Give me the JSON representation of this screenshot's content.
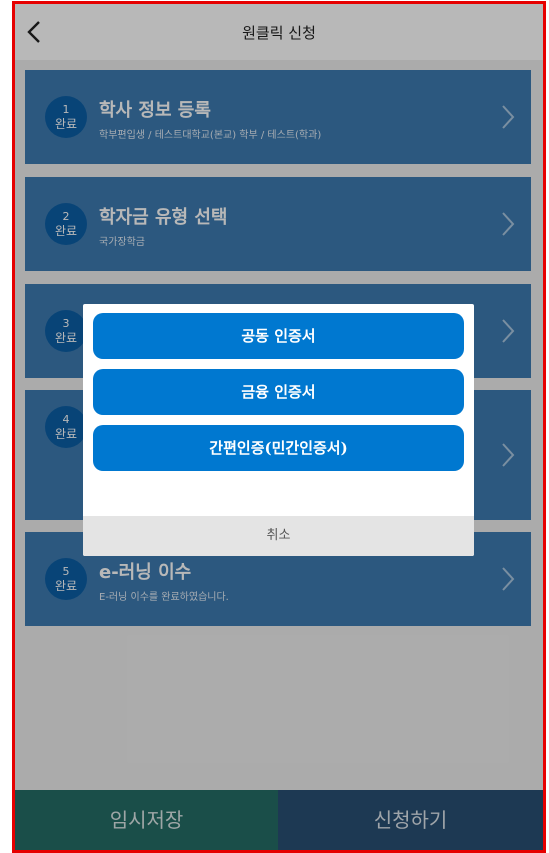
{
  "header": {
    "title": "원클릭 신청",
    "back_icon": "chevron-left-icon"
  },
  "steps": [
    {
      "num": "1",
      "status": "완료",
      "title": "학사 정보 등록",
      "subtitle": "학부편입생 / 테스트대학교(본교) 학부 / 테스트(학과)"
    },
    {
      "num": "2",
      "status": "완료",
      "title": "학자금 유형 선택",
      "subtitle": "국가장학금"
    },
    {
      "num": "3",
      "status": "완료",
      "title": "",
      "subtitle": ""
    },
    {
      "num": "4",
      "status": "완료",
      "title": "",
      "subtitle": ""
    },
    {
      "num": "5",
      "status": "완료",
      "title": "e-러닝 이수",
      "subtitle": "E-러닝 이수를 완료하였습니다."
    }
  ],
  "modal": {
    "options": [
      "공동 인증서",
      "금융 인증서",
      "간편인증(민간인증서)"
    ],
    "cancel": "취소"
  },
  "footer": {
    "save": "임시저장",
    "submit": "신청하기"
  },
  "colors": {
    "card": "#3d7ab0",
    "badge": "#0c5fa6",
    "modal_button": "#0078d0",
    "save": "#246c66",
    "submit": "#294f74",
    "frame": "#e60000"
  }
}
